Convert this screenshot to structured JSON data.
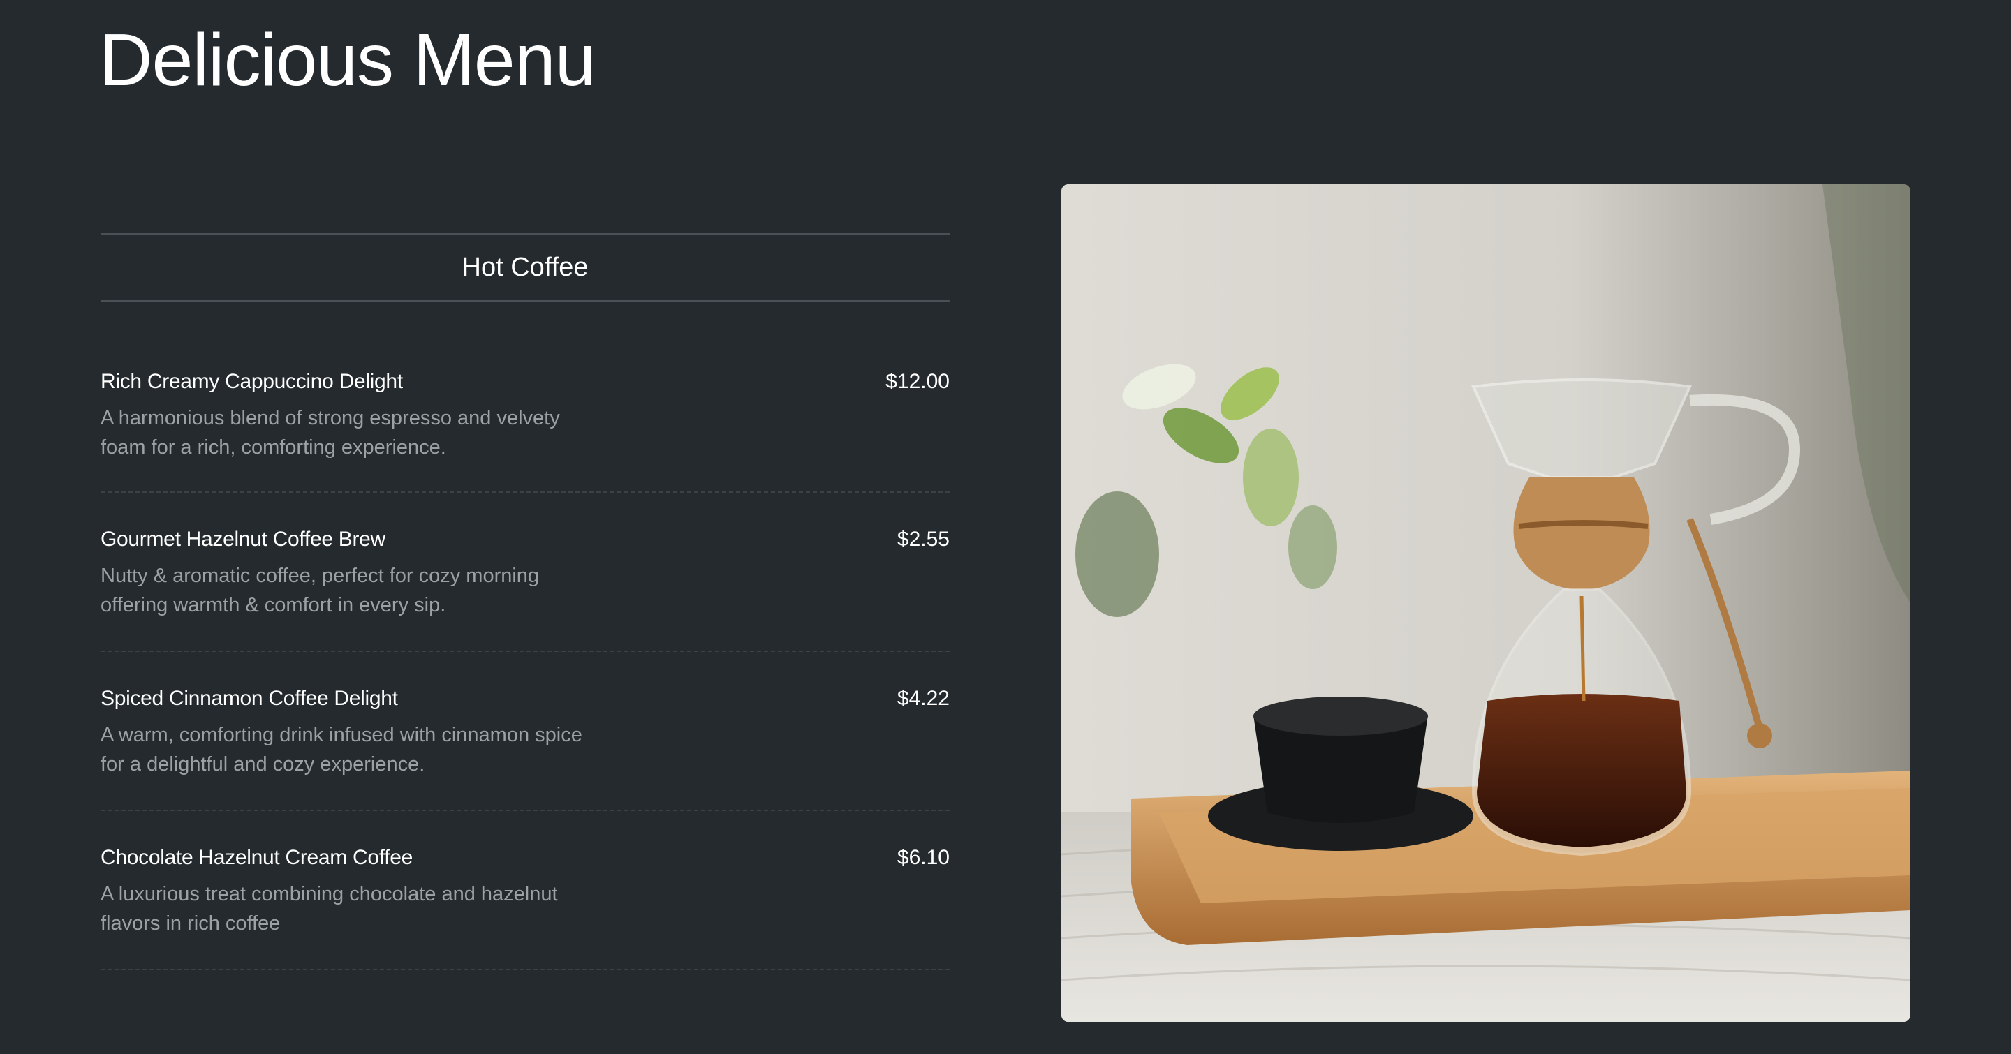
{
  "page": {
    "title": "Delicious Menu"
  },
  "category": {
    "title": "Hot Coffee"
  },
  "items": [
    {
      "name": "Rich Creamy Cappuccino Delight",
      "price": "$12.00",
      "description": "A harmonious blend of strong espresso and velvety foam for a rich, comforting experience."
    },
    {
      "name": "Gourmet Hazelnut Coffee Brew",
      "price": "$2.55",
      "description": "Nutty & aromatic coffee, perfect for cozy morning offering warmth & comfort in every sip."
    },
    {
      "name": "Spiced Cinnamon Coffee Delight",
      "price": "$4.22",
      "description": "A warm, comforting drink infused with cinnamon spice for a delightful and cozy experience."
    },
    {
      "name": "Chocolate Hazelnut Cream Coffee",
      "price": "$6.10",
      "description": "A luxurious treat combining chocolate and hazelnut flavors in rich coffee"
    }
  ],
  "colors": {
    "background": "#242a2e",
    "text": "#ffffff",
    "muted_text": "#9ba1a5",
    "divider": "#4a5156"
  }
}
